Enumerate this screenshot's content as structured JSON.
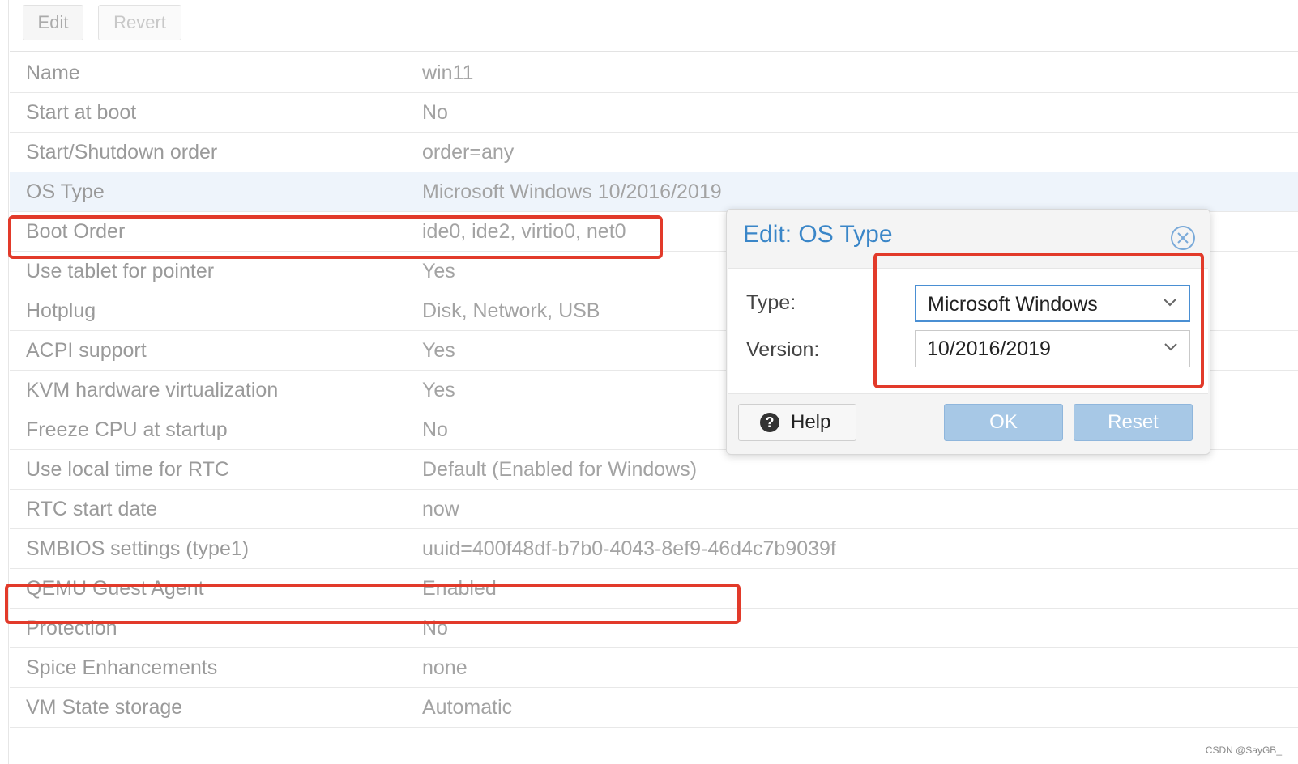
{
  "toolbar": {
    "edit_label": "Edit",
    "revert_label": "Revert"
  },
  "options": [
    {
      "key": "Name",
      "value": "win11"
    },
    {
      "key": "Start at boot",
      "value": "No"
    },
    {
      "key": "Start/Shutdown order",
      "value": "order=any"
    },
    {
      "key": "OS Type",
      "value": "Microsoft Windows 10/2016/2019"
    },
    {
      "key": "Boot Order",
      "value": "ide0, ide2, virtio0, net0"
    },
    {
      "key": "Use tablet for pointer",
      "value": "Yes"
    },
    {
      "key": "Hotplug",
      "value": "Disk, Network, USB"
    },
    {
      "key": "ACPI support",
      "value": "Yes"
    },
    {
      "key": "KVM hardware virtualization",
      "value": "Yes"
    },
    {
      "key": "Freeze CPU at startup",
      "value": "No"
    },
    {
      "key": "Use local time for RTC",
      "value": "Default (Enabled for Windows)"
    },
    {
      "key": "RTC start date",
      "value": "now"
    },
    {
      "key": "SMBIOS settings (type1)",
      "value": "uuid=400f48df-b7b0-4043-8ef9-46d4c7b9039f"
    },
    {
      "key": "QEMU Guest Agent",
      "value": "Enabled"
    },
    {
      "key": "Protection",
      "value": "No"
    },
    {
      "key": "Spice Enhancements",
      "value": "none"
    },
    {
      "key": "VM State storage",
      "value": "Automatic"
    }
  ],
  "selected_row": "OS Type",
  "dialog": {
    "title": "Edit: OS Type",
    "type_label": "Type:",
    "type_value": "Microsoft Windows",
    "version_label": "Version:",
    "version_value": "10/2016/2019",
    "help_label": "Help",
    "ok_label": "OK",
    "reset_label": "Reset"
  },
  "watermark": "CSDN @SayGB_",
  "colors": {
    "accent": "#3a86c8",
    "highlight": "#e23a2a",
    "button_disabled": "#a7c8e6",
    "selected_row": "#eef4fb"
  },
  "icons": {
    "close": "close-circle-icon",
    "dropdown": "chevron-down-icon",
    "help": "question-circle-icon"
  }
}
